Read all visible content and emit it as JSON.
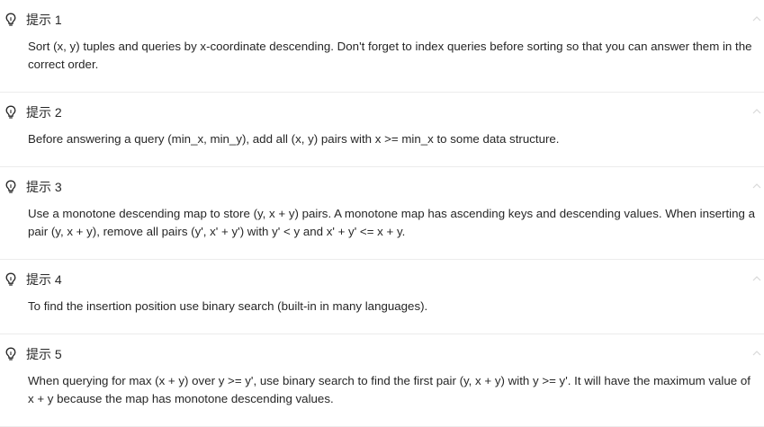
{
  "hints": [
    {
      "title": "提示 1",
      "body": "Sort (x, y) tuples and queries by x-coordinate descending. Don't forget to index queries before sorting so that you can answer them in the correct order."
    },
    {
      "title": "提示 2",
      "body": "Before answering a query (min_x, min_y), add all (x, y) pairs with x >= min_x to some data structure."
    },
    {
      "title": "提示 3",
      "body": "Use a monotone descending map to store (y, x + y) pairs. A monotone map has ascending keys and descending values. When inserting a pair (y, x + y), remove all pairs (y', x' + y') with y' < y and x' + y' <= x + y."
    },
    {
      "title": "提示 4",
      "body": "To find the insertion position use binary search (built-in in many languages)."
    },
    {
      "title": "提示 5",
      "body": "When querying for max (x + y) over y >= y', use binary search to find the first pair (y, x + y) with y >= y'. It will have the maximum value of x + y because the map has monotone descending values."
    }
  ],
  "icons": {
    "hint": "lightbulb-icon",
    "toggle": "chevron-up-icon"
  },
  "colors": {
    "text": "#262626",
    "divider": "#ececec",
    "chevron": "#d9d9d9"
  }
}
